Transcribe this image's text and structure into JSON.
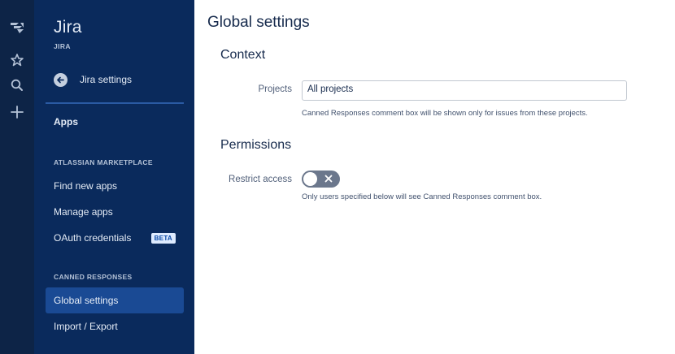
{
  "app": {
    "title": "Jira",
    "subtitle": "JIRA"
  },
  "rail": {
    "items": [
      "jira-logo-icon",
      "star-icon",
      "search-icon",
      "plus-icon"
    ]
  },
  "sidebar": {
    "back_label": "Jira settings",
    "apps_label": "Apps",
    "sections": [
      {
        "heading": "ATLASSIAN MARKETPLACE",
        "items": [
          {
            "label": "Find new apps"
          },
          {
            "label": "Manage apps"
          },
          {
            "label": "OAuth credentials",
            "badge": "BETA"
          }
        ]
      },
      {
        "heading": "CANNED RESPONSES",
        "items": [
          {
            "label": "Global settings",
            "selected": true
          },
          {
            "label": "Import / Export"
          }
        ]
      }
    ]
  },
  "main": {
    "title": "Global settings",
    "context": {
      "heading": "Context",
      "projects_label": "Projects",
      "projects_value": "All projects",
      "projects_help": "Canned Responses comment box will be shown only for issues from these projects."
    },
    "permissions": {
      "heading": "Permissions",
      "restrict_label": "Restrict access",
      "restrict_enabled": false,
      "restrict_help": "Only users specified below will see Canned Responses comment box."
    }
  },
  "colors": {
    "rail": "#0d2447",
    "sidebar": "#0a2a5c",
    "selected": "#1a4a94",
    "toggle_off": "#6b778c",
    "text": "#172b4d"
  }
}
